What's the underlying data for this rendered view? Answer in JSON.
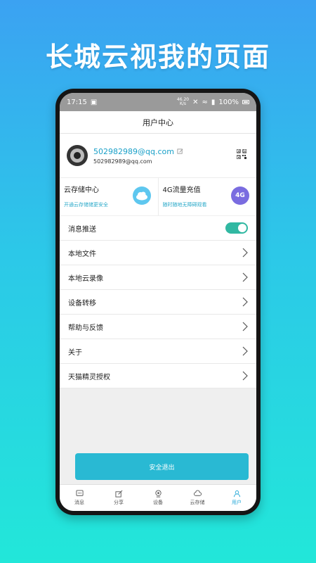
{
  "headline": "长城云视我的页面",
  "statusbar": {
    "time": "17:15",
    "net_speed_value": "46.20",
    "net_speed_unit": "K/s",
    "battery": "100%"
  },
  "header": {
    "title": "用户中心"
  },
  "profile": {
    "email": "502982989@qq.com",
    "email_sub": "502982989@qq.com"
  },
  "cards": [
    {
      "title": "云存储中心",
      "subtitle": "开通云存储储更安全",
      "icon": "cloud-icon"
    },
    {
      "title": "4G流量充值",
      "subtitle": "随时随地无障碍观看",
      "badge": "4G"
    }
  ],
  "menu": {
    "items": [
      {
        "label": "消息推送",
        "control": "toggle",
        "enabled": true
      },
      {
        "label": "本地文件"
      },
      {
        "label": "本地云录像"
      },
      {
        "label": "设备转移"
      },
      {
        "label": "帮助与反馈"
      },
      {
        "label": "关于"
      },
      {
        "label": "天猫精灵授权"
      }
    ]
  },
  "logout_label": "安全退出",
  "tabs": [
    {
      "label": "消息",
      "icon": "message-icon"
    },
    {
      "label": "分享",
      "icon": "share-icon"
    },
    {
      "label": "设备",
      "icon": "device-icon"
    },
    {
      "label": "云存储",
      "icon": "cloud-storage-icon"
    },
    {
      "label": "用户",
      "icon": "user-icon",
      "active": true
    }
  ],
  "colors": {
    "accent": "#29b9d3",
    "toggle_on": "#31b8a2",
    "active_tab": "#27a9d8"
  }
}
